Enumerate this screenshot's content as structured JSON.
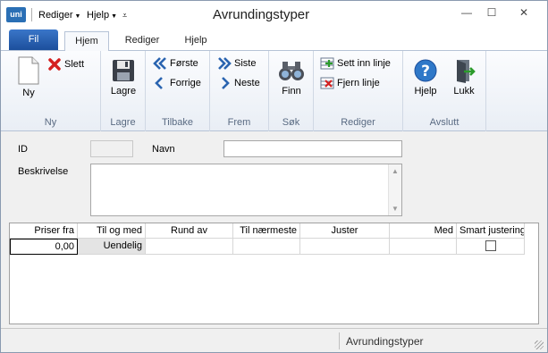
{
  "titlebar": {
    "app_logo": "uni",
    "menu_rediger": "Rediger",
    "menu_hjelp": "Hjelp",
    "title": "Avrundingstyper",
    "minimize": "—",
    "maximize": "☐",
    "close": "✕"
  },
  "tabs": {
    "fil": "Fil",
    "hjem": "Hjem",
    "rediger": "Rediger",
    "hjelp": "Hjelp"
  },
  "ribbon": {
    "ny": {
      "new_label": "Ny",
      "delete_label": "Slett",
      "group": "Ny"
    },
    "lagre": {
      "label": "Lagre",
      "group": "Lagre"
    },
    "tilbake": {
      "first": "Første",
      "previous": "Forrige",
      "group": "Tilbake"
    },
    "frem": {
      "last": "Siste",
      "next": "Neste",
      "group": "Frem"
    },
    "sok": {
      "label": "Finn",
      "group": "Søk"
    },
    "rediger": {
      "insert_row": "Sett inn linje",
      "remove_row": "Fjern linje",
      "group": "Rediger"
    },
    "avslutt": {
      "help": "Hjelp",
      "close": "Lukk",
      "group": "Avslutt"
    }
  },
  "form": {
    "id_label": "ID",
    "id_value": "",
    "name_label": "Navn",
    "name_value": "",
    "description_label": "Beskrivelse",
    "description_value": ""
  },
  "grid": {
    "columns": [
      "Priser fra",
      "Til og med",
      "Rund av",
      "Til nærmeste",
      "Juster",
      "Med",
      "Smart justering"
    ],
    "rows": [
      {
        "priser_fra": "0,00",
        "til_og_med": "Uendelig",
        "rund_av": "",
        "til_naermeste": "",
        "juster": "",
        "med": "",
        "smart_justering": false
      }
    ]
  },
  "status": {
    "text": "Avrundingstyper"
  },
  "colors": {
    "accent": "#1c4f9c",
    "ribbon_label": "#596a82"
  }
}
